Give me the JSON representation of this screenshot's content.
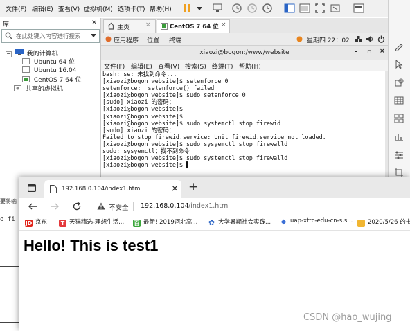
{
  "vm": {
    "menu": [
      "文件(F)",
      "编辑(E)",
      "查看(V)",
      "虚拟机(M)",
      "选项卡(T)",
      "帮助(H)"
    ],
    "library": {
      "title": "库",
      "close": "×",
      "search_placeholder": "在此处键入内容进行搜索",
      "tree": [
        "我的计算机",
        "Ubuntu 64 位",
        "Ubuntu 16.04",
        "CentOS 7 64 位",
        "共享的虚拟机"
      ]
    },
    "tabs": [
      {
        "label": "主页",
        "close": "×"
      },
      {
        "label": "CentOS 7 64 位",
        "close": "×"
      }
    ],
    "gnome": {
      "apps": "应用程序",
      "places": "位置",
      "terminal": "终端",
      "clock": "星期四 22：02"
    },
    "terminal": {
      "title": "xiaozi@bogon:/www/website",
      "controls": [
        "–",
        "▫",
        "×"
      ],
      "menu": [
        "文件(F)",
        "编辑(E)",
        "查看(V)",
        "搜索(S)",
        "终端(T)",
        "帮助(H)"
      ],
      "lines": [
        "bash: se: 未找到命令...",
        "[xiaozi@bogon website]$ setenforce 0",
        "setenforce:  setenforce() failed",
        "[xiaozi@bogon website]$ sudo setenforce 0",
        "[sudo] xiaozi 的密码：",
        "[xiaozi@bogon website]$",
        "[xiaozi@bogon website]$",
        "[xiaozi@bogon website]$ sudo systemctl stop firewid",
        "[sudo] xiaozi 的密码：",
        "Failed to stop firewid.service: Unit firewid.service not loaded.",
        "[xiaozi@bogon website]$ sudo sysyemctl stop firewalld",
        "sudo: sysyemctl：找不到命令",
        "[xiaozi@bogon website]$ sudo systemctl stop firewalld",
        "[xiaozi@bogon website]$ ▌"
      ]
    }
  },
  "left_strip": {
    "text1": "要将输",
    "text2": "o fi"
  },
  "browser": {
    "tab_title": "192.168.0.104/index1.html",
    "tab_close": "×",
    "new_tab": "+",
    "security": "不安全",
    "url_host": "192.168.0.104",
    "url_path": "/index1.html",
    "bookmarks": [
      {
        "icon": "JD",
        "color": "#e1251b",
        "label": "京东"
      },
      {
        "icon": "T",
        "color": "#e4393c",
        "label": "天猫精选-理想生活..."
      },
      {
        "icon": "百",
        "color": "#3aa63a",
        "label": "最新! 2019河北高..."
      },
      {
        "icon": "✿",
        "color": "#ffffff",
        "label": "大学暑期社会实践..."
      },
      {
        "icon": "◆",
        "color": "#3b6fd6",
        "label": "uap-xttc-edu-cn-s.s..."
      },
      {
        "icon": "▭",
        "color": "#f1b632",
        "label": "2020/5/26 的书"
      }
    ],
    "heading": "Hello! This is test1"
  },
  "watermark": "CSDN @hao_wujing",
  "colors": {
    "accent": "#1a73e8",
    "toolbar_orange": "#f0a020"
  }
}
